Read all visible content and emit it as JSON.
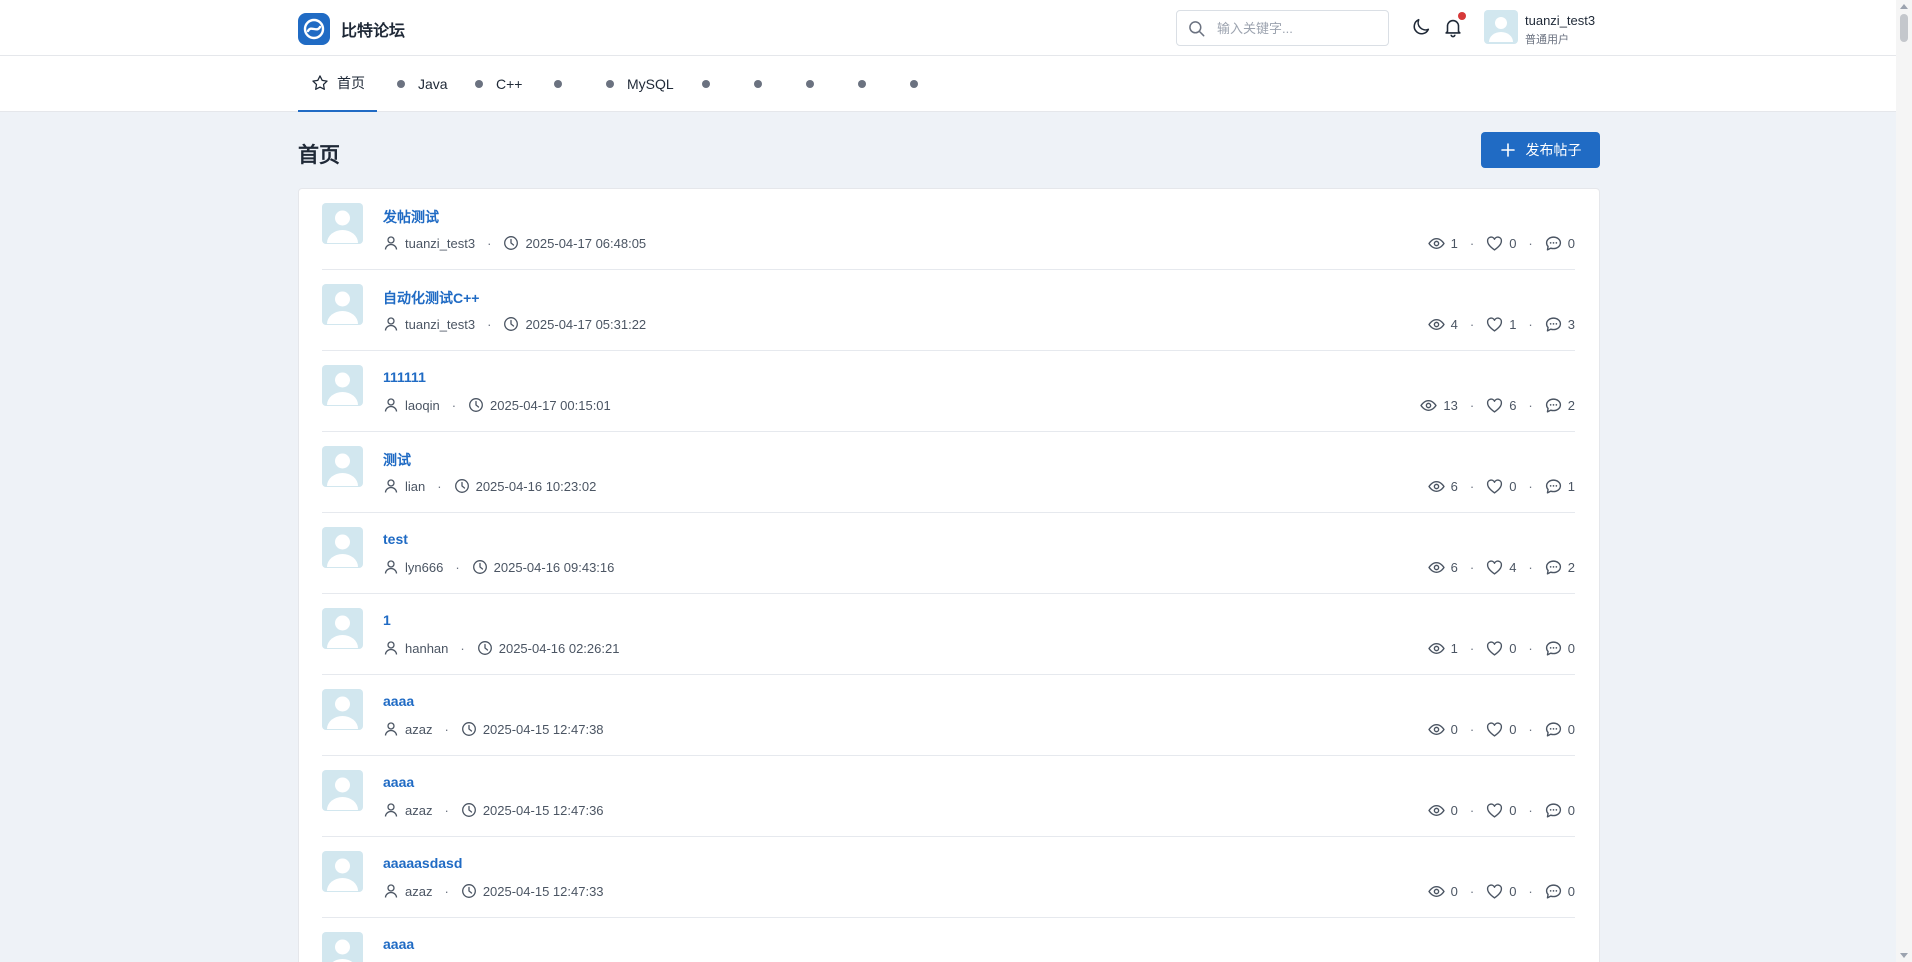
{
  "header": {
    "brand": "比特论坛",
    "search_placeholder": "输入关键字...",
    "user": {
      "name": "tuanzi_test3",
      "role": "普通用户"
    },
    "notification_dot_color": "#d63939"
  },
  "nav": {
    "tabs": [
      {
        "label": "首页",
        "active": true,
        "icon": "star-icon"
      },
      {
        "label": "Java"
      },
      {
        "label": "C++"
      },
      {
        "label": ""
      },
      {
        "label": "MySQL"
      },
      {
        "label": ""
      },
      {
        "label": ""
      },
      {
        "label": ""
      },
      {
        "label": ""
      },
      {
        "label": ""
      }
    ]
  },
  "page": {
    "title": "首页",
    "new_post_label": "发布帖子"
  },
  "posts": [
    {
      "title": "发帖测试",
      "author": "tuanzi_test3",
      "time": "2025-04-17 06:48:05",
      "views": "1",
      "likes": "0",
      "comments": "0"
    },
    {
      "title": "自动化测试C++",
      "author": "tuanzi_test3",
      "time": "2025-04-17 05:31:22",
      "views": "4",
      "likes": "1",
      "comments": "3"
    },
    {
      "title": "111111",
      "author": "laoqin",
      "time": "2025-04-17 00:15:01",
      "views": "13",
      "likes": "6",
      "comments": "2"
    },
    {
      "title": "测试",
      "author": "lian",
      "time": "2025-04-16 10:23:02",
      "views": "6",
      "likes": "0",
      "comments": "1"
    },
    {
      "title": "test",
      "author": "lyn666",
      "time": "2025-04-16 09:43:16",
      "views": "6",
      "likes": "4",
      "comments": "2"
    },
    {
      "title": "1",
      "author": "hanhan",
      "time": "2025-04-16 02:26:21",
      "views": "1",
      "likes": "0",
      "comments": "0"
    },
    {
      "title": "aaaa",
      "author": "azaz",
      "time": "2025-04-15 12:47:38",
      "views": "0",
      "likes": "0",
      "comments": "0"
    },
    {
      "title": "aaaa",
      "author": "azaz",
      "time": "2025-04-15 12:47:36",
      "views": "0",
      "likes": "0",
      "comments": "0"
    },
    {
      "title": "aaaaasdasd",
      "author": "azaz",
      "time": "2025-04-15 12:47:33",
      "views": "0",
      "likes": "0",
      "comments": "0"
    },
    {
      "title": "aaaa",
      "author": "",
      "time": "",
      "views": "",
      "likes": "",
      "comments": ""
    }
  ],
  "colors": {
    "accent": "#206bc4",
    "background": "#eef2f7",
    "avatar_bg": "#d2e7ef"
  }
}
